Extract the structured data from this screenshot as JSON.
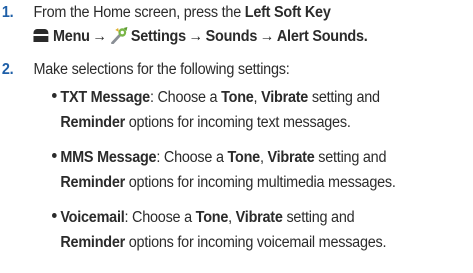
{
  "steps": [
    {
      "number": "1.",
      "line1_prefix": "From the Home screen, press the ",
      "line1_bold": "Left Soft Key",
      "path": {
        "menu_label": "Menu",
        "arrow": "→",
        "settings_label": "Settings",
        "sounds_label": "Sounds",
        "alert_sounds_label": "Alert Sounds",
        "end_period": "."
      },
      "icons": [
        "menu-soft-key-icon",
        "settings-icon"
      ]
    },
    {
      "number": "2.",
      "text": "Make selections for the following settings:"
    }
  ],
  "bullets": [
    {
      "name": "TXT Message",
      "colon_text": ": Choose a ",
      "tone": "Tone",
      "comma_text": ", ",
      "vibrate": "Vibrate",
      "setting_and": " setting and",
      "reminder": "Reminder",
      "rest": " options for incoming text messages."
    },
    {
      "name": "MMS Message",
      "colon_text": ": Choose a ",
      "tone": "Tone",
      "comma_text": ", ",
      "vibrate": "Vibrate",
      "setting_and": " setting and",
      "reminder": "Reminder",
      "rest": " options for incoming multimedia messages."
    },
    {
      "name": "Voicemail",
      "colon_text": ": Choose a ",
      "tone": "Tone",
      "comma_text": ", ",
      "vibrate": "Vibrate",
      "setting_and": " setting and",
      "reminder": "Reminder",
      "rest": " options for incoming voicemail messages."
    }
  ],
  "colors": {
    "step_number": "#1e5fa8",
    "text": "#2b2b2b",
    "settings_icon": "#7ab648"
  }
}
